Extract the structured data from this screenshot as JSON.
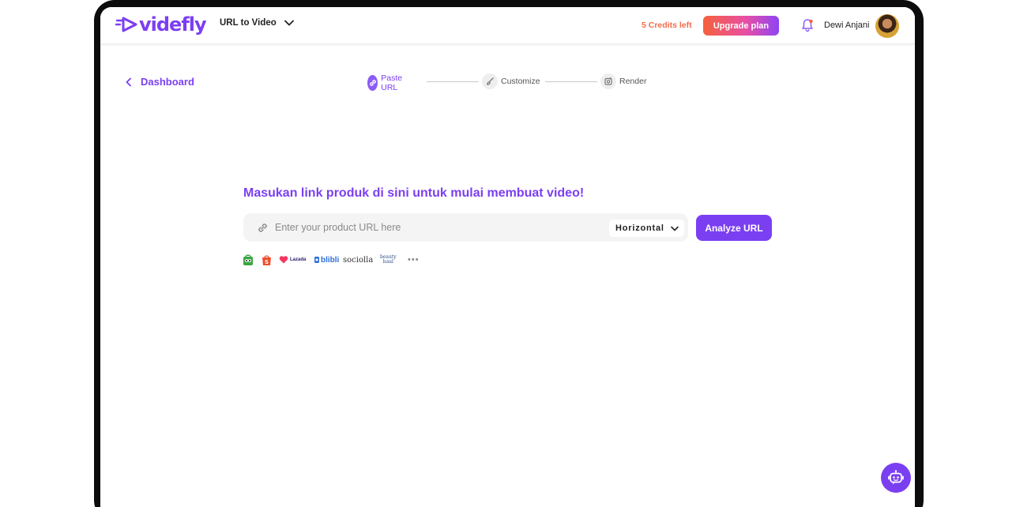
{
  "app": {
    "logo_text": "videfly",
    "brand_color": "#7b3ff2"
  },
  "header": {
    "mode_select": {
      "label": "URL to Video",
      "icon": "chevron-down-icon"
    },
    "credits": "5 Credits left",
    "upgrade_label": "Upgrade plan",
    "notification_icon": "bell-icon",
    "user_name": "Dewi Anjani"
  },
  "nav": {
    "back_label": "Dashboard"
  },
  "steps": [
    {
      "label": "Paste URL",
      "icon": "link-icon",
      "active": true
    },
    {
      "label": "Customize",
      "icon": "brush-icon",
      "active": false
    },
    {
      "label": "Render",
      "icon": "render-icon",
      "active": false
    }
  ],
  "main": {
    "headline": "Masukan link produk di sini untuk mulai membuat video!",
    "url_input": {
      "value": "",
      "placeholder": "Enter your product URL here"
    },
    "orientation": "Horizontal",
    "analyze_label": "Analyze URL"
  },
  "marketplaces": [
    {
      "name": "tokopedia-logo"
    },
    {
      "name": "shopee-logo"
    },
    {
      "name": "lazada-logo",
      "text": "Lazada"
    },
    {
      "name": "blibli-logo",
      "text": "blibli"
    },
    {
      "name": "sociolla-logo",
      "text": "sociolla"
    },
    {
      "name": "beautyhaul-logo",
      "text_line1": "beauty",
      "text_line2": "haul"
    },
    {
      "name": "more-icon",
      "text": "•••"
    }
  ],
  "assistant": {
    "icon": "bot-icon"
  }
}
